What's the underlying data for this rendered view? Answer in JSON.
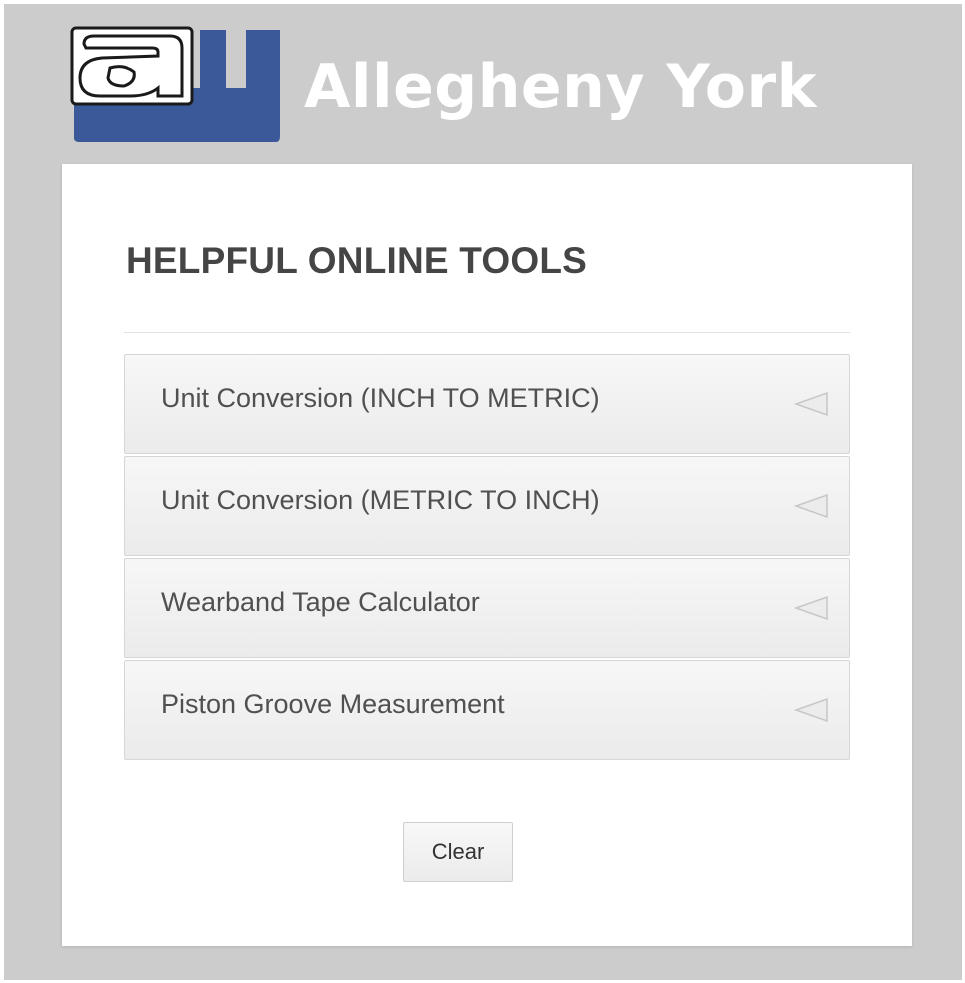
{
  "brand": {
    "logo_letters": "ay",
    "name": "Allegheny York",
    "logo_color": "#3b5998"
  },
  "page": {
    "title": "HELPFUL ONLINE TOOLS"
  },
  "tools": [
    {
      "label": "Unit Conversion (INCH TO METRIC)",
      "icon": "caret-left-icon"
    },
    {
      "label": "Unit Conversion (METRIC TO INCH)",
      "icon": "caret-left-icon"
    },
    {
      "label": "Wearband Tape Calculator",
      "icon": "caret-left-icon"
    },
    {
      "label": "Piston Groove Measurement",
      "icon": "caret-left-icon"
    }
  ],
  "actions": {
    "clear_label": "Clear"
  },
  "colors": {
    "background": "#cccccc",
    "card": "#ffffff",
    "title_text": "#454545",
    "item_text": "#505050"
  }
}
